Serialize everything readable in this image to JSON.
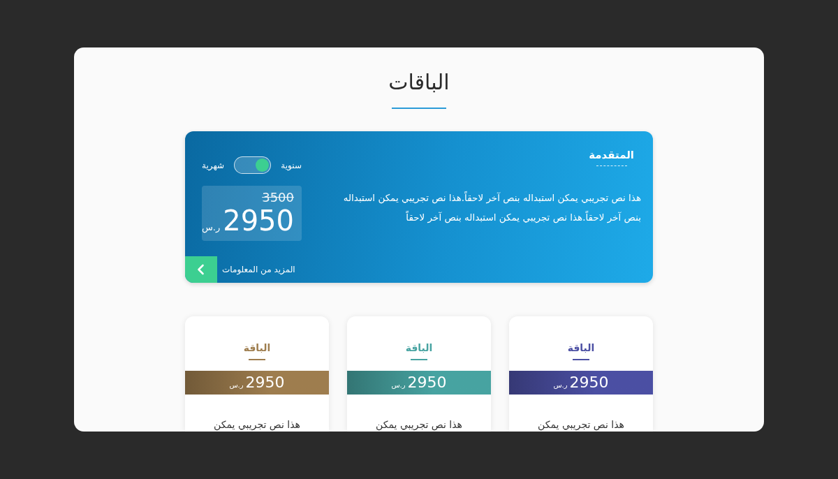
{
  "page_title": "الباقات",
  "featured_plan": {
    "name": "المتقدمة",
    "description": "هذا نص تجريبي يمكن استبداله بنص آخر لاحقاً.هذا نص تجريبي يمكن استبداله بنص آخر لاحقاً.هذا نص تجريبي يمكن استبداله بنص آخر لاحقاً",
    "period_switch": {
      "label_on": "سنوية",
      "label_off": "شهرية",
      "on": true
    },
    "old_price": "3500",
    "price": "2950",
    "currency": "ر.س",
    "more_link": "المزيد من المعلومات"
  },
  "plans": [
    {
      "name": "الباقة",
      "color": "#4b4fa3",
      "price": "2950",
      "currency": "ر.س",
      "description": "هذا نص تجريبي يمكن"
    },
    {
      "name": "الباقة",
      "color": "#47a3a1",
      "price": "2950",
      "currency": "ر.س",
      "description": "هذا نص تجريبي يمكن"
    },
    {
      "name": "الباقة",
      "color": "#9e7d4e",
      "price": "2950",
      "currency": "ر.س",
      "description": "هذا نص تجريبي يمكن"
    }
  ]
}
